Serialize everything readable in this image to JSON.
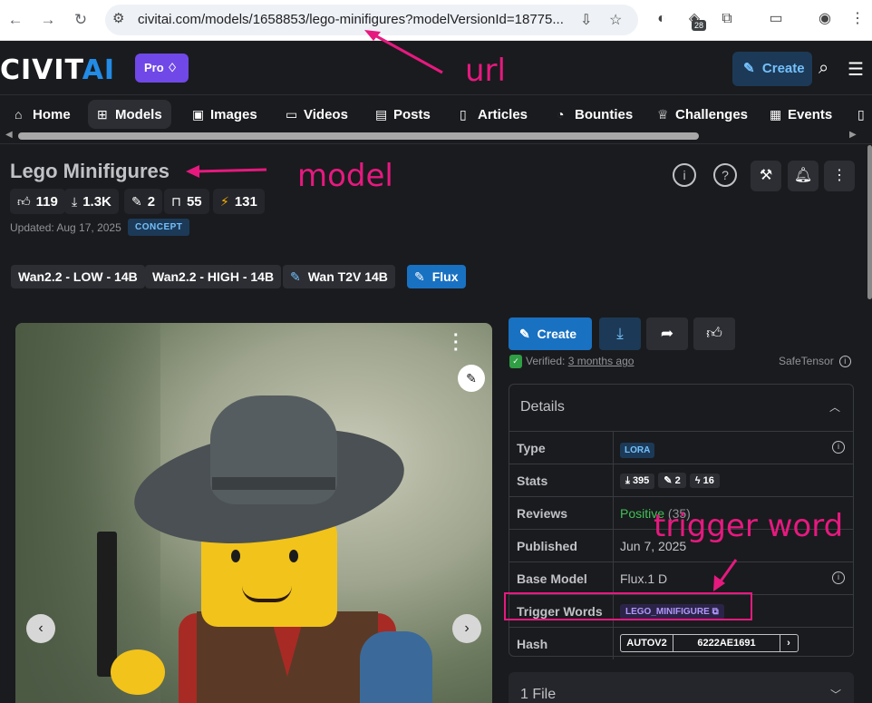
{
  "browser": {
    "url": "civitai.com/models/1658853/lego-minifigures?modelVersionId=18775...",
    "extension_badge": "28"
  },
  "site": {
    "logo_main": "CIVIT",
    "logo_accent": "AI",
    "pro_label": "Pro",
    "create_label": "Create"
  },
  "nav": {
    "tabs": [
      {
        "label": "Home",
        "icon": "home-icon"
      },
      {
        "label": "Models",
        "icon": "grid-icon"
      },
      {
        "label": "Images",
        "icon": "image-icon"
      },
      {
        "label": "Videos",
        "icon": "video-icon"
      },
      {
        "label": "Posts",
        "icon": "posts-icon"
      },
      {
        "label": "Articles",
        "icon": "article-icon"
      },
      {
        "label": "Bounties",
        "icon": "bounty-icon"
      },
      {
        "label": "Challenges",
        "icon": "trophy-icon"
      },
      {
        "label": "Events",
        "icon": "calendar-icon"
      }
    ]
  },
  "model": {
    "title": "Lego Minifigures",
    "stats": {
      "likes": "119",
      "downloads": "1.3K",
      "remixes": "2",
      "bookmarks": "55",
      "buzz": "131"
    },
    "updated": "Updated: Aug 17, 2025",
    "category": "CONCEPT",
    "versions": [
      "Wan2.2 - LOW - 14B",
      "Wan2.2 - HIGH - 14B",
      "Wan T2V 14B",
      "Flux"
    ]
  },
  "actions": {
    "create_label": "Create",
    "verified_prefix": "Verified:",
    "verified_time": "3 months ago",
    "safetensor": "SafeTensor"
  },
  "details": {
    "heading": "Details",
    "rows": {
      "type_label": "Type",
      "type_value": "LORA",
      "stats_label": "Stats",
      "stats_downloads": "395",
      "stats_remixes": "2",
      "stats_buzz": "16",
      "reviews_label": "Reviews",
      "reviews_value": "Positive",
      "reviews_count": "(35)",
      "published_label": "Published",
      "published_value": "Jun 7, 2025",
      "base_label": "Base Model",
      "base_value": "Flux.1 D",
      "trigger_label": "Trigger Words",
      "trigger_value": "LEGO_MINIFIGURE",
      "hash_label": "Hash",
      "hash_algo": "AUTOV2",
      "hash_value": "6222AE1691"
    }
  },
  "files": {
    "label": "1 File"
  },
  "annotations": {
    "url": "url",
    "model": "model",
    "trigger": "trigger word"
  },
  "colors": {
    "accent": "#1971c2",
    "annotation": "#e6197f",
    "pro": "#7048e8",
    "positive": "#40c057"
  }
}
